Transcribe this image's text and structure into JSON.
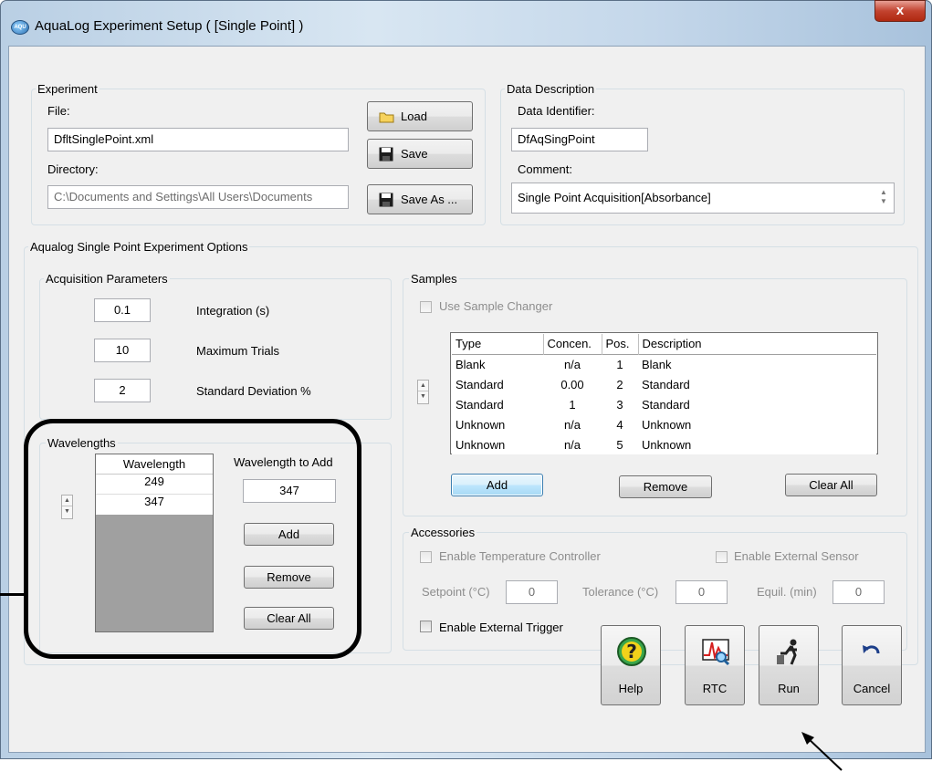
{
  "window": {
    "title": "AquaLog Experiment Setup ( [Single Point] )",
    "close_label": "x"
  },
  "experiment": {
    "legend": "Experiment",
    "file_label": "File:",
    "file_value": "DfltSinglePoint.xml",
    "directory_label": "Directory:",
    "directory_value": "C:\\Documents and Settings\\All Users\\Documents",
    "load_label": "Load",
    "save_label": "Save",
    "save_as_label": "Save As ..."
  },
  "data_description": {
    "legend": "Data Description",
    "identifier_label": "Data Identifier:",
    "identifier_value": "DfAqSingPoint",
    "comment_label": "Comment:",
    "comment_value": "Single Point Acquisition[Absorbance]"
  },
  "options": {
    "legend": "Aqualog Single Point Experiment Options",
    "acquisition": {
      "legend": "Acquisition Parameters",
      "integration_value": "0.1",
      "integration_label": "Integration (s)",
      "max_trials_value": "10",
      "max_trials_label": "Maximum Trials",
      "std_dev_value": "2",
      "std_dev_label": "Standard Deviation %"
    },
    "wavelengths": {
      "legend": "Wavelengths",
      "column_header": "Wavelength",
      "rows": [
        "249",
        "347"
      ],
      "to_add_label": "Wavelength to Add",
      "to_add_value": "347",
      "add_label": "Add",
      "remove_label": "Remove",
      "clear_all_label": "Clear All"
    },
    "samples": {
      "legend": "Samples",
      "use_changer_label": "Use Sample Changer",
      "columns": [
        "Type",
        "Concen.",
        "Pos.",
        "Description"
      ],
      "rows": [
        [
          "Blank",
          "n/a",
          "1",
          "Blank"
        ],
        [
          "Standard",
          "0.00",
          "2",
          "Standard"
        ],
        [
          "Standard",
          "1",
          "3",
          "Standard"
        ],
        [
          "Unknown",
          "n/a",
          "4",
          "Unknown"
        ],
        [
          "Unknown",
          "n/a",
          "5",
          "Unknown"
        ]
      ],
      "add_label": "Add",
      "remove_label": "Remove",
      "clear_all_label": "Clear All"
    },
    "accessories": {
      "legend": "Accessories",
      "temp_controller_label": "Enable Temperature Controller",
      "external_sensor_label": "Enable External Sensor",
      "setpoint_label": "Setpoint (°C)",
      "setpoint_value": "0",
      "tolerance_label": "Tolerance (°C)",
      "tolerance_value": "0",
      "equil_label": "Equil. (min)",
      "equil_value": "0",
      "external_trigger_label": "Enable External Trigger"
    }
  },
  "footer": {
    "help_label": "Help",
    "rtc_label": "RTC",
    "run_label": "Run",
    "cancel_label": "Cancel"
  }
}
